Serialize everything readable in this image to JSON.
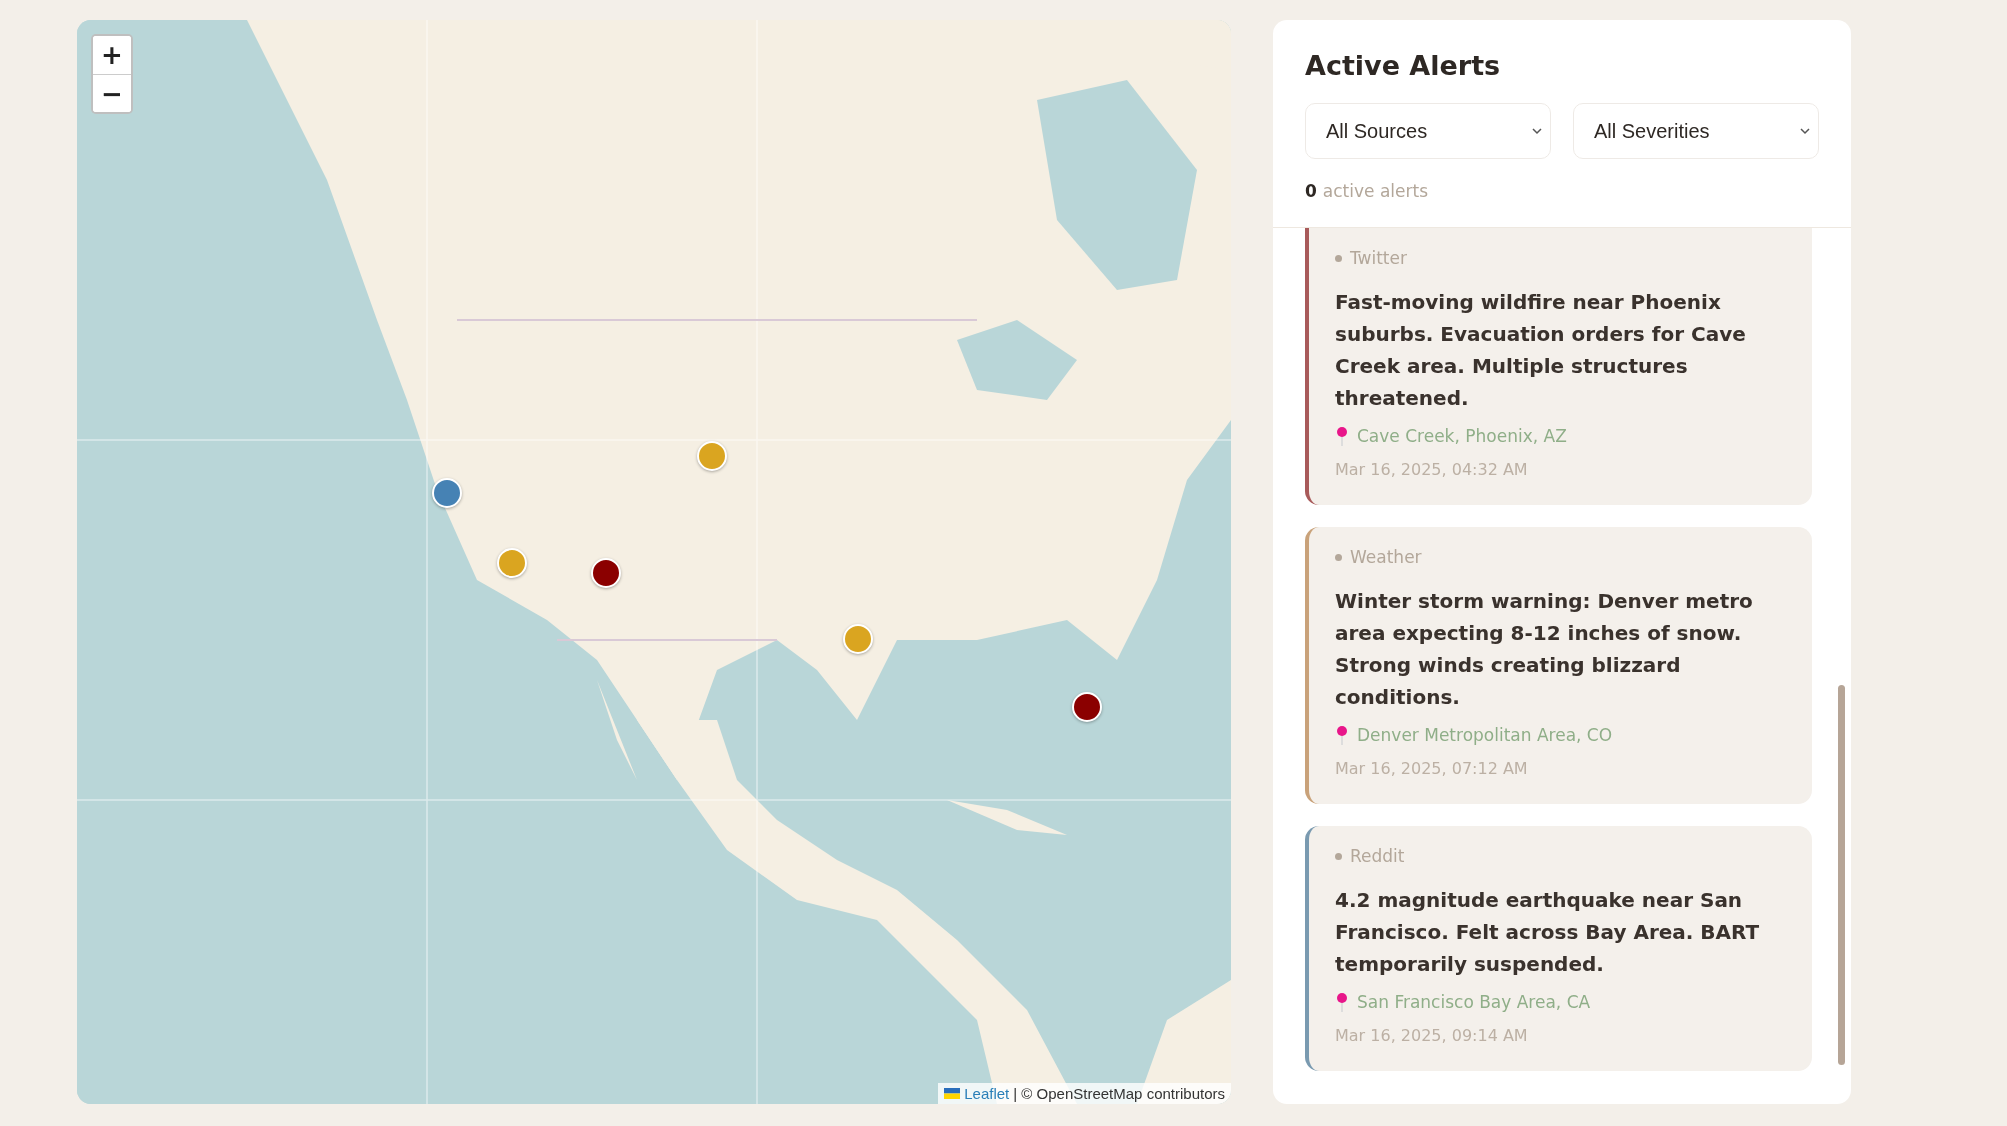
{
  "map": {
    "zoom_in": "+",
    "zoom_out": "−",
    "markers": [
      {
        "color": "#4682b4"
      },
      {
        "color": "#daa520"
      },
      {
        "color": "#8b0000"
      },
      {
        "color": "#daa520"
      },
      {
        "color": "#daa520"
      },
      {
        "color": "#8b0000"
      }
    ],
    "attribution": {
      "link": "Leaflet",
      "text": "| © OpenStreetMap contributors"
    }
  },
  "panel": {
    "title": "Active Alerts",
    "filters": [
      {
        "value": "All Sources"
      },
      {
        "value": "All Severities"
      }
    ],
    "count": {
      "number": "0",
      "label": "active alerts"
    },
    "alerts": [
      {
        "source": "Twitter",
        "text": "Fast-moving wildfire near Phoenix suburbs. Evacuation orders for Cave Creek area. Multiple structures threatened.",
        "location": "Cave Creek, Phoenix, AZ",
        "time": "Mar 16, 2025, 04:32 AM",
        "color": "#a85a5a"
      },
      {
        "source": "Weather",
        "text": "Winter storm warning: Denver metro area expecting 8-12 inches of snow. Strong winds creating blizzard conditions.",
        "location": "Denver Metropolitan Area, CO",
        "time": "Mar 16, 2025, 07:12 AM",
        "color": "#c9a27a"
      },
      {
        "source": "Reddit",
        "text": "4.2 magnitude earthquake near San Francisco. Felt across Bay Area. BART temporarily suspended.",
        "location": "San Francisco Bay Area, CA",
        "time": "Mar 16, 2025, 09:14 AM",
        "color": "#7a9ab0"
      }
    ]
  }
}
